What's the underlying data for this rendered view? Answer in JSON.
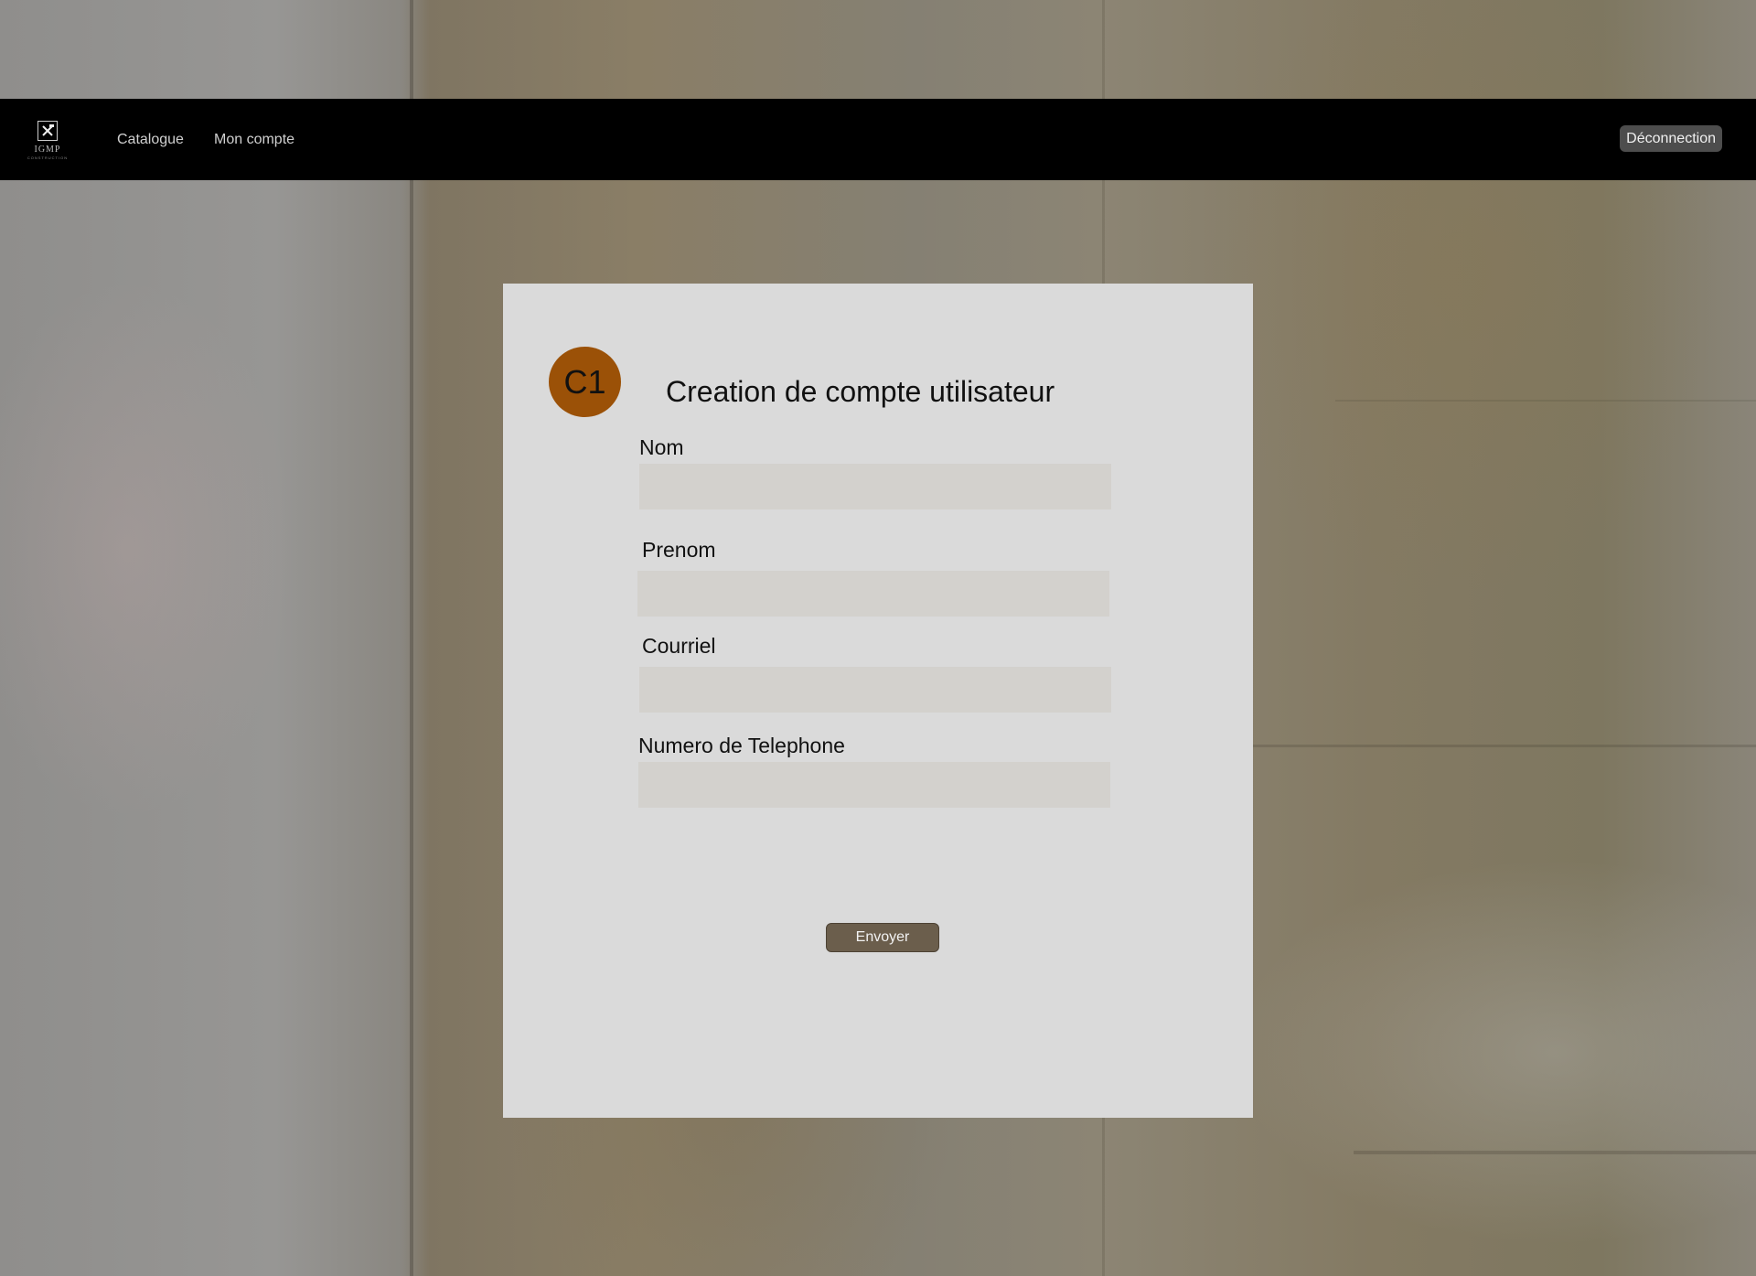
{
  "brand": {
    "logo_text": "IGMP",
    "logo_subtext": "CONSTRUCTION"
  },
  "nav": {
    "items": [
      {
        "label": "Catalogue"
      },
      {
        "label": "Mon compte"
      }
    ],
    "logout_label": "Déconnection"
  },
  "form": {
    "avatar_initials": "C1",
    "title": "Creation de compte utilisateur",
    "fields": [
      {
        "label": "Nom",
        "value": ""
      },
      {
        "label": "Prenom",
        "value": ""
      },
      {
        "label": "Courriel",
        "value": ""
      },
      {
        "label": "Numero de Telephone",
        "value": ""
      }
    ],
    "submit_label": "Envoyer"
  },
  "colors": {
    "header_bg": "#000000",
    "card_bg": "#dadada",
    "avatar_bg": "#9b5107",
    "submit_bg": "#6b5e4c",
    "input_bg": "#d3d1cd"
  }
}
